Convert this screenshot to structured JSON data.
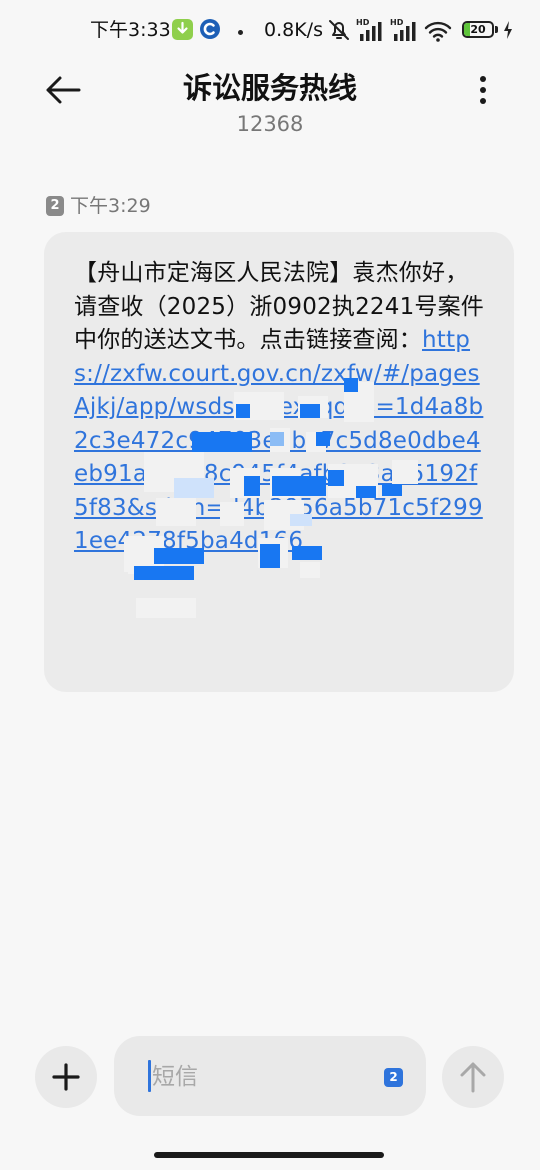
{
  "status_bar": {
    "time": "下午3:33",
    "net_speed": "0.8K/s",
    "battery_text": "20",
    "battery_level": 0.2,
    "signal_1_label": "HD",
    "signal_2_label": "HD",
    "icons": [
      "download-icon",
      "app-icon",
      "mute-icon",
      "signal-icon",
      "wifi-icon",
      "battery-icon",
      "charging-icon"
    ]
  },
  "header": {
    "title": "诉讼服务热线",
    "subtitle": "12368"
  },
  "message": {
    "sim_slot": "2",
    "time": "下午3:29",
    "text_before_link": "【舟山市定海区人民法院】袁杰你好，请查收（2025）浙0902执2241号案件中你的送达文书。点击链接查阅：",
    "link_text": "https://zxfw.court.gov.cn/zxfw/#/pagesAjkj/app/wsds/index?qdbs=1d4a8b2c3e472c94703e6ba7c5d8e0dbe4eb91aac4b8c945f4afb8e3a15192f5f83&sdsin=d4b2956a5b71c5f2991ee4278f5ba4d166"
  },
  "composer": {
    "placeholder": "短信",
    "sim_slot": "2"
  },
  "colors": {
    "accent": "#2f74dc",
    "bubble": "#ebebeb",
    "background": "#f7f7f7"
  }
}
